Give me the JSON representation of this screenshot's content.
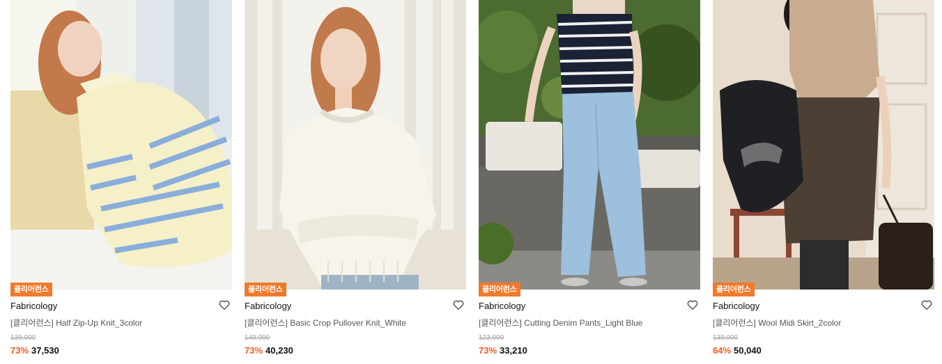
{
  "products": [
    {
      "badge": "클리어런스",
      "brand": "Fabricology",
      "name": "[클리어런스] Half Zip-Up Knit_3color",
      "original_price": "139,000",
      "discount": "73%",
      "price": "37,530",
      "image": "woman-in-cream-blue-striped-half-zip-knit"
    },
    {
      "badge": "클리어런스",
      "brand": "Fabricology",
      "name": "[클리어런스] Basic Crop Pullover Knit_White",
      "original_price": "149,000",
      "discount": "73%",
      "price": "40,230",
      "image": "woman-in-white-crop-pullover-knit"
    },
    {
      "badge": "클리어런스",
      "brand": "Fabricology",
      "name": "[클리어런스] Cutting Denim Pants_Light Blue",
      "original_price": "123,000",
      "discount": "73%",
      "price": "33,210",
      "image": "woman-in-striped-top-and-light-blue-denim"
    },
    {
      "badge": "클리어런스",
      "brand": "Fabricology",
      "name": "[클리어런스] Wool Midi Skirt_2color",
      "original_price": "139,000",
      "discount": "64%",
      "price": "50,040",
      "image": "woman-in-beige-top-and-brown-wool-skirt"
    }
  ],
  "colors": {
    "badge_bg": "#f07a2c",
    "discount": "#ee5a24",
    "strike_price": "#a0a0a0"
  },
  "icons": {
    "wishlist": "heart-outline-icon"
  }
}
